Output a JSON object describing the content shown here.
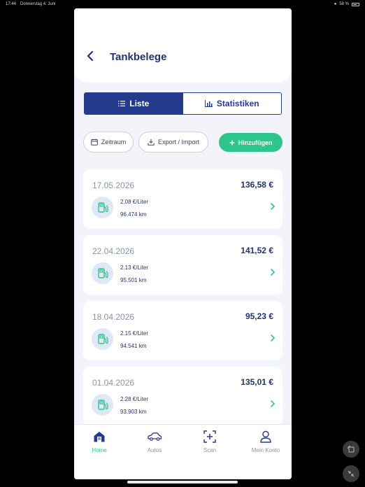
{
  "status_bar": {
    "time": "17:44",
    "date": "Donnerstag 4. Juni",
    "battery": "58 %"
  },
  "header": {
    "back_icon": "chevron-left-icon",
    "title": "Tankbelege"
  },
  "segment": {
    "list_label": "Liste",
    "stats_label": "Statistiken",
    "active": "Liste"
  },
  "actions": {
    "zeitraum_label": "Zeitraum",
    "export_label": "Export / Import",
    "add_label": "Hinzufügen"
  },
  "receipts": [
    {
      "date": "17.05.2026",
      "amount": "136,58 €",
      "price": "2.08 €/Liter",
      "km": "96.474 km"
    },
    {
      "date": "22.04.2026",
      "amount": "141,52 €",
      "price": "2.13 €/Liter",
      "km": "95.501 km"
    },
    {
      "date": "18.04.2026",
      "amount": "95,23 €",
      "price": "2.15 €/Liter",
      "km": "94.541 km"
    },
    {
      "date": "01.04.2026",
      "amount": "135,01 €",
      "price": "2.28 €/Liter",
      "km": "93.903 km"
    }
  ],
  "tabbar": {
    "home": "Home",
    "autos": "Autos",
    "scan": "Scan",
    "account": "Mein Konto",
    "active": "Home"
  },
  "colors": {
    "primary": "#243a8c",
    "accent": "#2cc58a",
    "background": "#f2f4f9"
  }
}
